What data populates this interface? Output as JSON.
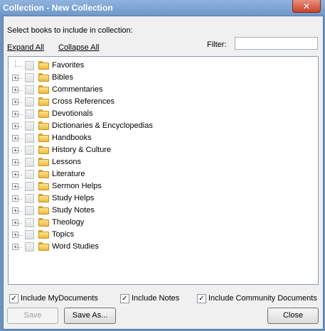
{
  "window": {
    "title": "Collection - New Collection",
    "close_glyph": "✕"
  },
  "prompt": "Select books to include in collection:",
  "links": {
    "expand_all": "Expand All",
    "collapse_all": "Collapse All"
  },
  "filter": {
    "label": "Filter:",
    "value": ""
  },
  "tree": [
    {
      "label": "Favorites",
      "expandable": false,
      "checked": false
    },
    {
      "label": "Bibles",
      "expandable": true,
      "checked": false
    },
    {
      "label": "Commentaries",
      "expandable": true,
      "checked": false
    },
    {
      "label": "Cross References",
      "expandable": true,
      "checked": false
    },
    {
      "label": "Devotionals",
      "expandable": true,
      "checked": false
    },
    {
      "label": "Dictionaries & Encyclopedias",
      "expandable": true,
      "checked": false
    },
    {
      "label": "Handbooks",
      "expandable": true,
      "checked": false
    },
    {
      "label": "History & Culture",
      "expandable": true,
      "checked": false
    },
    {
      "label": "Lessons",
      "expandable": true,
      "checked": false
    },
    {
      "label": "Literature",
      "expandable": true,
      "checked": false
    },
    {
      "label": "Sermon Helps",
      "expandable": true,
      "checked": false
    },
    {
      "label": "Study Helps",
      "expandable": true,
      "checked": false
    },
    {
      "label": "Study Notes",
      "expandable": true,
      "checked": false
    },
    {
      "label": "Theology",
      "expandable": true,
      "checked": false
    },
    {
      "label": "Topics",
      "expandable": true,
      "checked": false
    },
    {
      "label": "Word Studies",
      "expandable": true,
      "checked": false
    }
  ],
  "options": {
    "mydocuments": {
      "label": "Include MyDocuments",
      "checked": true
    },
    "notes": {
      "label": "Include Notes",
      "checked": true
    },
    "community": {
      "label": "Include Community Documents",
      "checked": true
    }
  },
  "buttons": {
    "save": "Save",
    "save_as": "Save As...",
    "close": "Close"
  },
  "check_glyph": "✓",
  "expander_glyph": "+"
}
